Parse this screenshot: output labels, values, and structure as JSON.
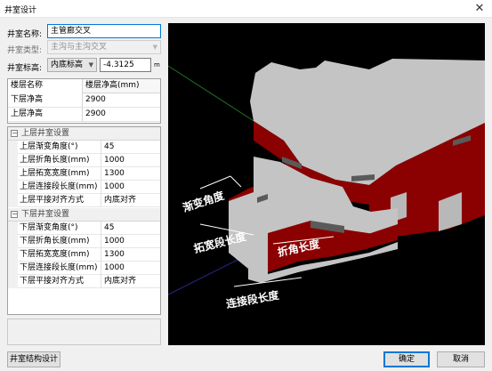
{
  "window": {
    "title": "井室设计",
    "close_glyph": "✕"
  },
  "form": {
    "name_label": "井室名称:",
    "name_value": "主管廊交叉",
    "type_label": "井室类型:",
    "type_value": "主沟与主沟交叉",
    "elev_label": "井室标高:",
    "elev_mode": "内底标高",
    "elev_value": "-4.3125",
    "elev_unit": "m"
  },
  "floors_table": {
    "headers": [
      "楼层名称",
      "楼层净高(mm)"
    ],
    "rows": [
      {
        "name": "下层净高",
        "value": "2900"
      },
      {
        "name": "上层净高",
        "value": "2900"
      }
    ]
  },
  "property_grid": {
    "groups": [
      {
        "title": "上层井室设置",
        "toggle": "⊟",
        "rows": [
          {
            "name": "上层渐变角度(°)",
            "value": "45"
          },
          {
            "name": "上层折角长度(mm)",
            "value": "1000"
          },
          {
            "name": "上层拓宽宽度(mm)",
            "value": "1300"
          },
          {
            "name": "上层连接段长度(mm)",
            "value": "1000"
          },
          {
            "name": "上层平接对齐方式",
            "value": "内底对齐"
          }
        ]
      },
      {
        "title": "下层井室设置",
        "toggle": "⊟",
        "rows": [
          {
            "name": "下层渐变角度(°)",
            "value": "45"
          },
          {
            "name": "下层折角长度(mm)",
            "value": "1000"
          },
          {
            "name": "下层拓宽宽度(mm)",
            "value": "1300"
          },
          {
            "name": "下层连接段长度(mm)",
            "value": "1000"
          },
          {
            "name": "下层平接对齐方式",
            "value": "内底对齐"
          }
        ]
      }
    ]
  },
  "viewport": {
    "annotations": {
      "gradient_angle": "渐变角度",
      "widen_length": "拓宽段长度",
      "fold_length": "折角长度",
      "connect_length": "连接段长度"
    },
    "colors": {
      "background": "#000000",
      "wall_red": "#8b0000",
      "slab_grey": "#c3c3c3",
      "accent_dark": "#5a5a5a"
    }
  },
  "buttons": {
    "structure": "井室结构设计",
    "ok": "确定",
    "cancel": "取消"
  }
}
